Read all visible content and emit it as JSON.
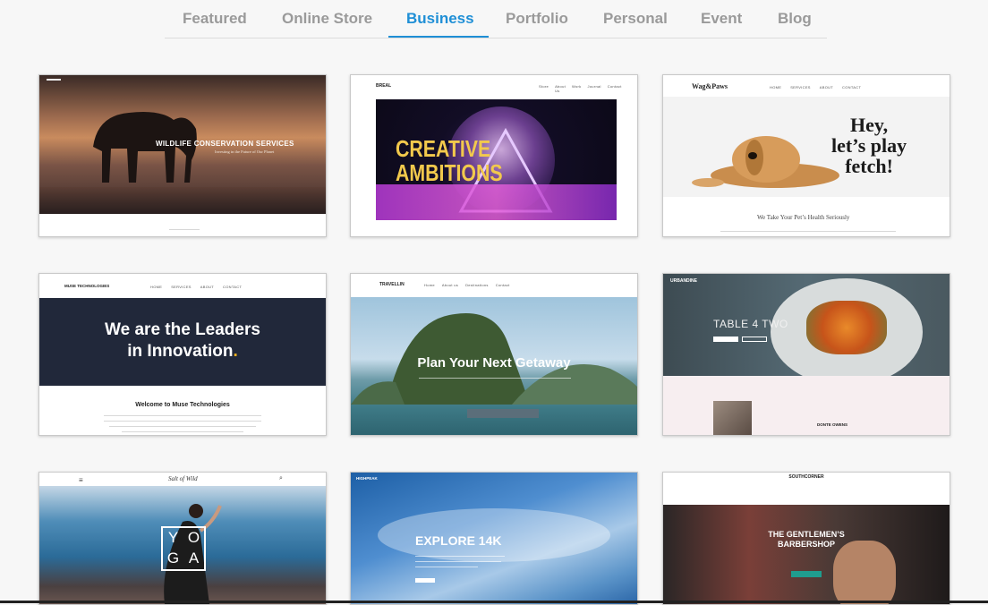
{
  "tabs": [
    {
      "label": "Featured"
    },
    {
      "label": "Online Store"
    },
    {
      "label": "Business",
      "active": true
    },
    {
      "label": "Portfolio"
    },
    {
      "label": "Personal"
    },
    {
      "label": "Event"
    },
    {
      "label": "Blog"
    }
  ],
  "accent_color": "#1f8fd6",
  "templates": {
    "wildlife": {
      "title": "WILDLIFE CONSERVATION SERVICES",
      "subtitle": "Investing in the Future of Our Planet"
    },
    "breal": {
      "logo": "BREAL",
      "nav": [
        "Store",
        "About Us",
        "Work",
        "Journal",
        "Contact"
      ],
      "headline_1": "CREATIVE",
      "headline_2": "AMBITIONS"
    },
    "wagpaws": {
      "logo": "Wag&Paws",
      "nav": [
        "HOME",
        "SERVICES",
        "ABOUT",
        "CONTACT"
      ],
      "hero_1": "Hey,",
      "hero_2": "let’s play",
      "hero_3": "fetch!",
      "tagline": "We Take Your Pet’s Health Seriously"
    },
    "muse": {
      "logo": "MUSE TECHNOLOGIES",
      "nav": [
        "HOME",
        "SERVICES",
        "ABOUT",
        "CONTACT"
      ],
      "hero_1": "We are the Leaders",
      "hero_2": "in Innovation",
      "hero_dot": ".",
      "welcome": "Welcome to Muse Technologies"
    },
    "travellin": {
      "logo": "TRAVELLIN",
      "nav": [
        "Home",
        "About us",
        "Destinations",
        "Contact"
      ],
      "headline": "Plan Your Next Getaway"
    },
    "urbandine": {
      "logo": "URBANDINE",
      "headline": "TABLE 4 TWO",
      "chef": "DONTE OWENS"
    },
    "yoga": {
      "logo": "Salt of Wild",
      "letters": [
        "Y",
        "O",
        "G",
        "A"
      ]
    },
    "highpeak": {
      "logo": "HIGHPEAK",
      "headline": "EXPLORE 14K"
    },
    "southcorner": {
      "logo": "SOUTHCORNER",
      "headline_1": "THE GENTLEMEN’S",
      "headline_2": "BARBERSHOP"
    }
  }
}
